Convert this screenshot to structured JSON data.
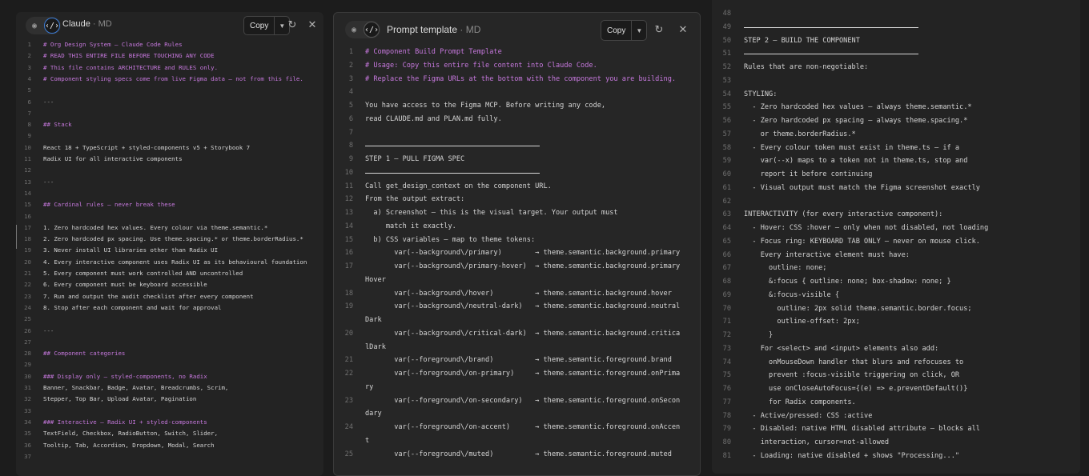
{
  "panel1": {
    "title": "Claude",
    "title_sub": " · MD",
    "copy_label": "Copy",
    "lines": [
      {
        "n": "1",
        "t": "# Org Design System — Claude Code Rules",
        "k": "c-comment"
      },
      {
        "n": "2",
        "t": "# READ THIS ENTIRE FILE BEFORE TOUCHING ANY CODE",
        "k": "c-comment"
      },
      {
        "n": "3",
        "t": "# This file contains ARCHITECTURE and RULES only.",
        "k": "c-comment"
      },
      {
        "n": "4",
        "t": "# Component styling specs come from live Figma data — not from this file.",
        "k": "c-comment"
      },
      {
        "n": "5",
        "t": "",
        "k": "c-code"
      },
      {
        "n": "6",
        "t": "---",
        "k": "c-dim"
      },
      {
        "n": "7",
        "t": "",
        "k": "c-code"
      },
      {
        "n": "8",
        "t": "## Stack",
        "k": "c-head"
      },
      {
        "n": "9",
        "t": "",
        "k": "c-code"
      },
      {
        "n": "10",
        "t": "React 18 + TypeScript + styled-components v5 + Storybook 7",
        "k": "c-code"
      },
      {
        "n": "11",
        "t": "Radix UI for all interactive components",
        "k": "c-code"
      },
      {
        "n": "12",
        "t": "",
        "k": "c-code"
      },
      {
        "n": "13",
        "t": "---",
        "k": "c-dim"
      },
      {
        "n": "14",
        "t": "",
        "k": "c-code"
      },
      {
        "n": "15",
        "t": "## Cardinal rules — never break these",
        "k": "c-head"
      },
      {
        "n": "16",
        "t": "",
        "k": "c-code"
      },
      {
        "n": "17",
        "t": "1. Zero hardcoded hex values. Every colour via theme.semantic.*",
        "k": "c-code"
      },
      {
        "n": "18",
        "t": "2. Zero hardcoded px spacing. Use theme.spacing.* or theme.borderRadius.*",
        "k": "c-code"
      },
      {
        "n": "19",
        "t": "3. Never install UI libraries other than Radix UI",
        "k": "c-code"
      },
      {
        "n": "20",
        "t": "4. Every interactive component uses Radix UI as its behavioural foundation",
        "k": "c-code"
      },
      {
        "n": "21",
        "t": "5. Every component must work controlled AND uncontrolled",
        "k": "c-code"
      },
      {
        "n": "22",
        "t": "6. Every component must be keyboard accessible",
        "k": "c-code"
      },
      {
        "n": "23",
        "t": "7. Run and output the audit checklist after every component",
        "k": "c-code"
      },
      {
        "n": "24",
        "t": "8. Stop after each component and wait for approval",
        "k": "c-code"
      },
      {
        "n": "25",
        "t": "",
        "k": "c-code"
      },
      {
        "n": "26",
        "t": "---",
        "k": "c-dim"
      },
      {
        "n": "27",
        "t": "",
        "k": "c-code"
      },
      {
        "n": "28",
        "t": "## Component categories",
        "k": "c-head"
      },
      {
        "n": "29",
        "t": "",
        "k": "c-code"
      },
      {
        "n": "30",
        "t": "### Display only — styled-components, no Radix",
        "k": "c-head"
      },
      {
        "n": "31",
        "t": "Banner, Snackbar, Badge, Avatar, Breadcrumbs, Scrim,",
        "k": "c-code"
      },
      {
        "n": "32",
        "t": "Stepper, Top Bar, Upload Avatar, Pagination",
        "k": "c-code"
      },
      {
        "n": "33",
        "t": "",
        "k": "c-code"
      },
      {
        "n": "34",
        "t": "### Interactive — Radix UI + styled-components",
        "k": "c-head"
      },
      {
        "n": "35",
        "t": "TextField, Checkbox, RadioButton, Switch, Slider,",
        "k": "c-code"
      },
      {
        "n": "36",
        "t": "Tooltip, Tab, Accordion, Dropdown, Modal, Search",
        "k": "c-code"
      },
      {
        "n": "37",
        "t": "",
        "k": "c-code"
      }
    ]
  },
  "panel2": {
    "title": "Prompt template",
    "title_sub": " · MD",
    "copy_label": "Copy",
    "lines": [
      {
        "n": "1",
        "t": "# Component Build Prompt Template",
        "k": "c-comment"
      },
      {
        "n": "2",
        "t": "# Usage: Copy this entire file content into Claude Code.",
        "k": "c-comment"
      },
      {
        "n": "3",
        "t": "# Replace the Figma URLs at the bottom with the component you are building.",
        "k": "c-comment"
      },
      {
        "n": "4",
        "t": "",
        "k": "c-code"
      },
      {
        "n": "5",
        "t": "You have access to the Figma MCP. Before writing any code,",
        "k": "c-code"
      },
      {
        "n": "6",
        "t": "read CLAUDE.md and PLAN.md fully.",
        "k": "c-code"
      },
      {
        "n": "7",
        "t": "",
        "k": "c-code"
      },
      {
        "n": "8",
        "t": "",
        "k": "c-code",
        "rule": true
      },
      {
        "n": "9",
        "t": "STEP 1 — PULL FIGMA SPEC",
        "k": "c-code"
      },
      {
        "n": "10",
        "t": "",
        "k": "c-code",
        "rule": true
      },
      {
        "n": "11",
        "t": "Call get_design_context on the component URL.",
        "k": "c-code"
      },
      {
        "n": "12",
        "t": "From the output extract:",
        "k": "c-code"
      },
      {
        "n": "13",
        "t": "  a) Screenshot — this is the visual target. Your output must",
        "k": "c-code"
      },
      {
        "n": "14",
        "t": "     match it exactly.",
        "k": "c-code"
      },
      {
        "n": "15",
        "t": "  b) CSS variables — map to theme tokens:",
        "k": "c-code"
      },
      {
        "n": "16",
        "t": "       var(--background\\/primary)        → theme.semantic.background.primary",
        "k": "c-code"
      },
      {
        "n": "17",
        "t": "       var(--background\\/primary-hover)  → theme.semantic.background.primary",
        "k": "c-code"
      },
      {
        "n": "",
        "t": "Hover",
        "k": "c-code"
      },
      {
        "n": "18",
        "t": "       var(--background\\/hover)          → theme.semantic.background.hover",
        "k": "c-code"
      },
      {
        "n": "19",
        "t": "       var(--background\\/neutral-dark)   → theme.semantic.background.neutral",
        "k": "c-code"
      },
      {
        "n": "",
        "t": "Dark",
        "k": "c-code"
      },
      {
        "n": "20",
        "t": "       var(--background\\/critical-dark)  → theme.semantic.background.critica",
        "k": "c-code"
      },
      {
        "n": "",
        "t": "lDark",
        "k": "c-code"
      },
      {
        "n": "21",
        "t": "       var(--foreground\\/brand)          → theme.semantic.foreground.brand",
        "k": "c-code"
      },
      {
        "n": "22",
        "t": "       var(--foreground\\/on-primary)     → theme.semantic.foreground.onPrima",
        "k": "c-code"
      },
      {
        "n": "",
        "t": "ry",
        "k": "c-code"
      },
      {
        "n": "23",
        "t": "       var(--foreground\\/on-secondary)   → theme.semantic.foreground.onSecon",
        "k": "c-code"
      },
      {
        "n": "",
        "t": "dary",
        "k": "c-code"
      },
      {
        "n": "24",
        "t": "       var(--foreground\\/on-accent)      → theme.semantic.foreground.onAccen",
        "k": "c-code"
      },
      {
        "n": "",
        "t": "t",
        "k": "c-code"
      },
      {
        "n": "25",
        "t": "       var(--foreground\\/muted)          → theme.semantic.foreground.muted",
        "k": "c-code"
      }
    ]
  },
  "panel3": {
    "lines": [
      {
        "n": "48",
        "t": "",
        "k": "c-code"
      },
      {
        "n": "49",
        "t": "",
        "k": "c-code",
        "rule": true
      },
      {
        "n": "50",
        "t": "STEP 2 — BUILD THE COMPONENT",
        "k": "c-code"
      },
      {
        "n": "51",
        "t": "",
        "k": "c-code",
        "rule": true
      },
      {
        "n": "52",
        "t": "Rules that are non-negotiable:",
        "k": "c-code"
      },
      {
        "n": "53",
        "t": "",
        "k": "c-code"
      },
      {
        "n": "54",
        "t": "STYLING:",
        "k": "c-code"
      },
      {
        "n": "55",
        "t": "  - Zero hardcoded hex values — always theme.semantic.*",
        "k": "c-code"
      },
      {
        "n": "56",
        "t": "  - Zero hardcoded px spacing — always theme.spacing.*",
        "k": "c-code"
      },
      {
        "n": "57",
        "t": "    or theme.borderRadius.*",
        "k": "c-code"
      },
      {
        "n": "58",
        "t": "  - Every colour token must exist in theme.ts — if a",
        "k": "c-code"
      },
      {
        "n": "59",
        "t": "    var(--x) maps to a token not in theme.ts, stop and",
        "k": "c-code"
      },
      {
        "n": "60",
        "t": "    report it before continuing",
        "k": "c-code"
      },
      {
        "n": "61",
        "t": "  - Visual output must match the Figma screenshot exactly",
        "k": "c-code"
      },
      {
        "n": "62",
        "t": "",
        "k": "c-code"
      },
      {
        "n": "63",
        "t": "INTERACTIVITY (for every interactive component):",
        "k": "c-code"
      },
      {
        "n": "64",
        "t": "  - Hover: CSS :hover — only when not disabled, not loading",
        "k": "c-code"
      },
      {
        "n": "65",
        "t": "  - Focus ring: KEYBOARD TAB ONLY — never on mouse click.",
        "k": "c-code"
      },
      {
        "n": "66",
        "t": "    Every interactive element must have:",
        "k": "c-code"
      },
      {
        "n": "67",
        "t": "      outline: none;",
        "k": "c-code"
      },
      {
        "n": "68",
        "t": "      &:focus { outline: none; box-shadow: none; }",
        "k": "c-code"
      },
      {
        "n": "69",
        "t": "      &:focus-visible {",
        "k": "c-code"
      },
      {
        "n": "70",
        "t": "        outline: 2px solid theme.semantic.border.focus;",
        "k": "c-code"
      },
      {
        "n": "71",
        "t": "        outline-offset: 2px;",
        "k": "c-code"
      },
      {
        "n": "72",
        "t": "      }",
        "k": "c-code"
      },
      {
        "n": "73",
        "t": "    For <select> and <input> elements also add:",
        "k": "c-code"
      },
      {
        "n": "74",
        "t": "      onMouseDown handler that blurs and refocuses to",
        "k": "c-code"
      },
      {
        "n": "75",
        "t": "      prevent :focus-visible triggering on click, OR",
        "k": "c-code"
      },
      {
        "n": "76",
        "t": "      use onCloseAutoFocus={(e) => e.preventDefault()}",
        "k": "c-code"
      },
      {
        "n": "77",
        "t": "      for Radix components.",
        "k": "c-code"
      },
      {
        "n": "78",
        "t": "  - Active/pressed: CSS :active",
        "k": "c-code"
      },
      {
        "n": "79",
        "t": "  - Disabled: native HTML disabled attribute — blocks all",
        "k": "c-code"
      },
      {
        "n": "80",
        "t": "    interaction, cursor=not-allowed",
        "k": "c-code"
      },
      {
        "n": "81",
        "t": "  - Loading: native disabled + shows \"Processing...\"",
        "k": "c-code"
      }
    ]
  },
  "icons": {
    "eye": "eye-icon",
    "code": "code-icon",
    "chevron": "chevron-down-icon",
    "refresh": "refresh-icon",
    "close": "close-icon"
  }
}
